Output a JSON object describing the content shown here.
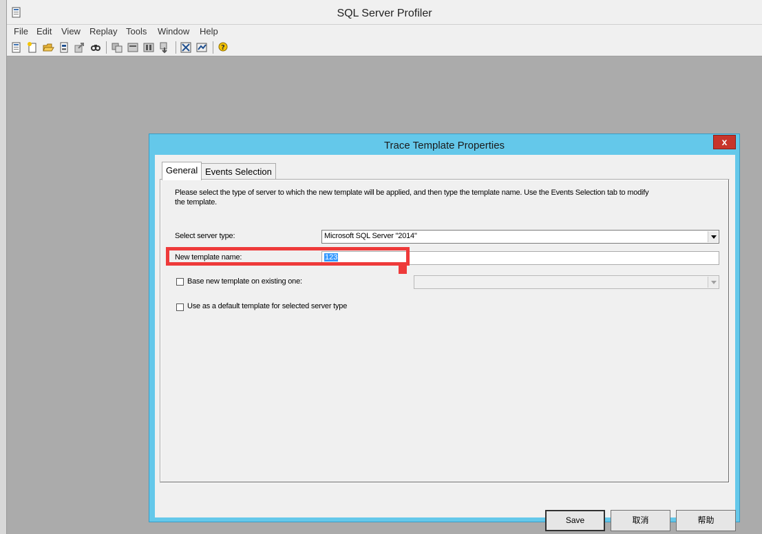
{
  "app": {
    "title": "SQL Server Profiler",
    "menu": [
      "File",
      "Edit",
      "View",
      "Replay",
      "Tools",
      "Window",
      "Help"
    ],
    "toolbar_icons": [
      "new-trace-icon",
      "new-template-icon",
      "open-icon",
      "properties-icon",
      "export-icon",
      "find-icon",
      "start-icon",
      "pause-icon",
      "stop-icon",
      "step-icon",
      "replay-icon",
      "chart-icon",
      "help-icon"
    ]
  },
  "dialog": {
    "title": "Trace Template Properties",
    "close_label": "x",
    "tabs": [
      "General",
      "Events Selection"
    ],
    "description": "Please select the type of server to which the new template will be applied, and then type the template name.  Use the Events Selection tab to modify the template.",
    "server_type_label": "Select server type:",
    "server_type_value": "Microsoft SQL Server \"2014\"",
    "template_name_label": "New template name:",
    "template_name_value": "123",
    "base_on_existing_label": "Base new template on existing one:",
    "base_on_existing_value": "",
    "default_template_label": "Use as a default template for selected server type",
    "buttons": {
      "save": "Save",
      "cancel": "取消",
      "help": "帮助"
    }
  },
  "colors": {
    "dialog_frame": "#64c8ea",
    "highlight": "#ee3a3a",
    "close_button": "#c7352b",
    "selection": "#3399ff"
  }
}
